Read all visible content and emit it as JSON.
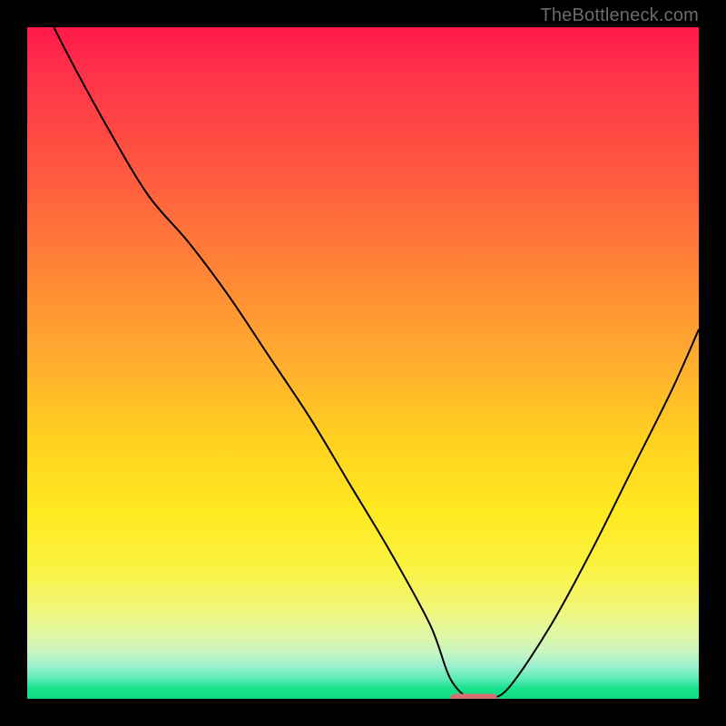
{
  "watermark": "TheBottleneck.com",
  "colors": {
    "background": "#000000",
    "gradient_top": "#ff1a4a",
    "gradient_bottom": "#0fdc82",
    "curve": "#000000",
    "marker": "#d66f6f"
  },
  "chart_data": {
    "type": "line",
    "title": "",
    "xlabel": "",
    "ylabel": "",
    "xlim": [
      0,
      100
    ],
    "ylim": [
      0,
      100
    ],
    "annotations": [
      "TheBottleneck.com"
    ],
    "marker": {
      "x_range": [
        63,
        70
      ],
      "y": 0
    },
    "series": [
      {
        "name": "bottleneck-curve",
        "x": [
          0,
          6,
          12,
          18,
          24,
          30,
          36,
          42,
          48,
          54,
          60,
          63,
          66,
          69,
          72,
          78,
          84,
          90,
          96,
          100
        ],
        "y": [
          108,
          96,
          85,
          75,
          68,
          60,
          51,
          42,
          32,
          22,
          11,
          3,
          0,
          0,
          2,
          11,
          22,
          34,
          46,
          55
        ]
      }
    ]
  }
}
